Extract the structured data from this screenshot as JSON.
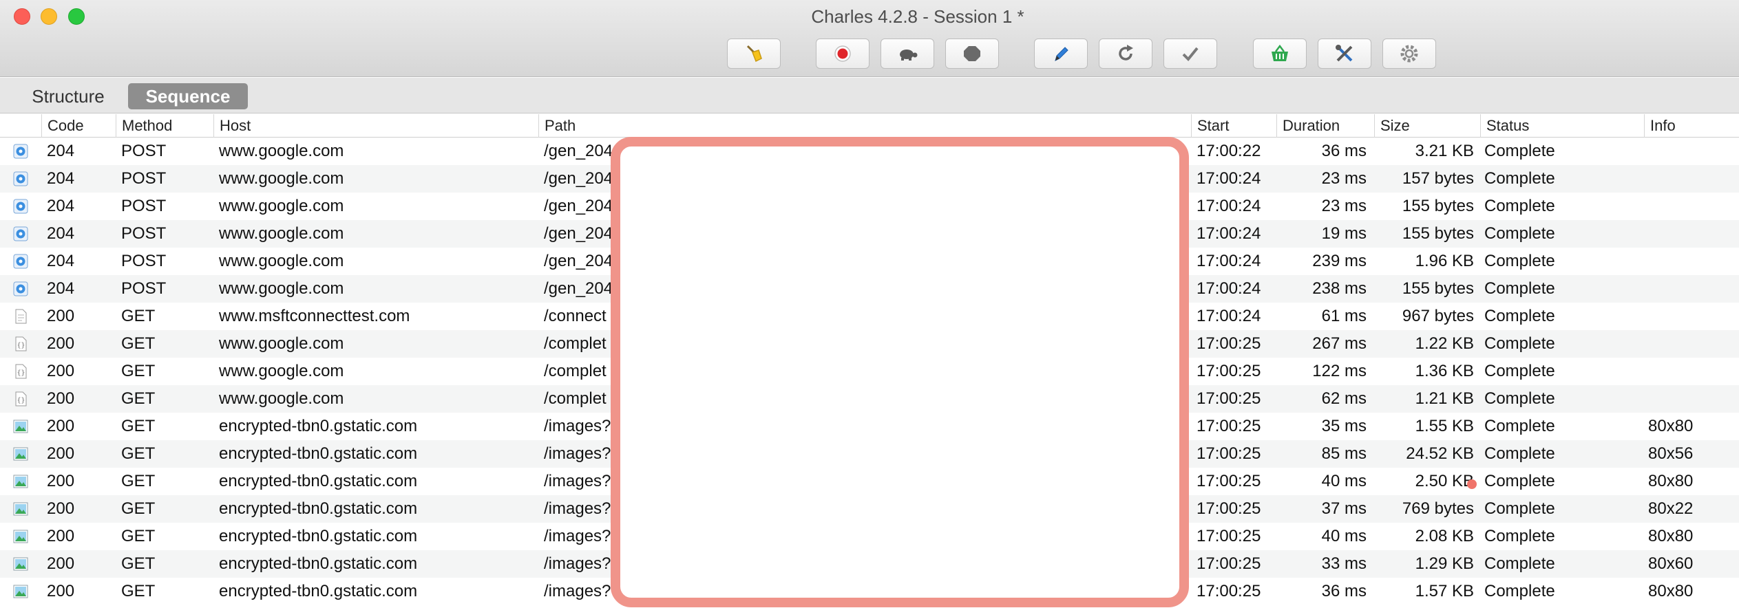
{
  "window": {
    "title": "Charles 4.2.8 - Session 1 *"
  },
  "toolbar": {
    "buttons": [
      {
        "name": "broom-icon"
      },
      {
        "name": "record-icon"
      },
      {
        "name": "turtle-icon"
      },
      {
        "name": "stop-icon"
      },
      {
        "name": "pen-icon"
      },
      {
        "name": "repeat-icon"
      },
      {
        "name": "checkmark-icon"
      },
      {
        "name": "basket-icon"
      },
      {
        "name": "tools-icon"
      },
      {
        "name": "gear-icon"
      }
    ],
    "record_color": "#e0262b",
    "basket_color": "#2fa84f",
    "pen_color": "#2f7fd8"
  },
  "tabs": {
    "structure": "Structure",
    "sequence": "Sequence",
    "active": "Sequence"
  },
  "table": {
    "columns": {
      "code": "Code",
      "method": "Method",
      "host": "Host",
      "path": "Path",
      "start": "Start",
      "duration": "Duration",
      "size": "Size",
      "status": "Status",
      "info": "Info"
    },
    "rows": [
      {
        "icon": "globe",
        "code": "204",
        "method": "POST",
        "host": "www.google.com",
        "path": "/gen_204",
        "start": "17:00:22",
        "duration": "36 ms",
        "size": "3.21 KB",
        "status": "Complete",
        "info": ""
      },
      {
        "icon": "globe",
        "code": "204",
        "method": "POST",
        "host": "www.google.com",
        "path": "/gen_204",
        "start": "17:00:24",
        "duration": "23 ms",
        "size": "157 bytes",
        "status": "Complete",
        "info": ""
      },
      {
        "icon": "globe",
        "code": "204",
        "method": "POST",
        "host": "www.google.com",
        "path": "/gen_204",
        "start": "17:00:24",
        "duration": "23 ms",
        "size": "155 bytes",
        "status": "Complete",
        "info": ""
      },
      {
        "icon": "globe",
        "code": "204",
        "method": "POST",
        "host": "www.google.com",
        "path": "/gen_204",
        "start": "17:00:24",
        "duration": "19 ms",
        "size": "155 bytes",
        "status": "Complete",
        "info": ""
      },
      {
        "icon": "globe",
        "code": "204",
        "method": "POST",
        "host": "www.google.com",
        "path": "/gen_204",
        "start": "17:00:24",
        "duration": "239 ms",
        "size": "1.96 KB",
        "status": "Complete",
        "info": ""
      },
      {
        "icon": "globe",
        "code": "204",
        "method": "POST",
        "host": "www.google.com",
        "path": "/gen_204",
        "start": "17:00:24",
        "duration": "238 ms",
        "size": "155 bytes",
        "status": "Complete",
        "info": ""
      },
      {
        "icon": "document",
        "code": "200",
        "method": "GET",
        "host": "www.msftconnecttest.com",
        "path": "/connect",
        "start": "17:00:24",
        "duration": "61 ms",
        "size": "967 bytes",
        "status": "Complete",
        "info": ""
      },
      {
        "icon": "json",
        "code": "200",
        "method": "GET",
        "host": "www.google.com",
        "path": "/complet",
        "start": "17:00:25",
        "duration": "267 ms",
        "size": "1.22 KB",
        "status": "Complete",
        "info": ""
      },
      {
        "icon": "json",
        "code": "200",
        "method": "GET",
        "host": "www.google.com",
        "path": "/complet",
        "start": "17:00:25",
        "duration": "122 ms",
        "size": "1.36 KB",
        "status": "Complete",
        "info": ""
      },
      {
        "icon": "json",
        "code": "200",
        "method": "GET",
        "host": "www.google.com",
        "path": "/complet",
        "start": "17:00:25",
        "duration": "62 ms",
        "size": "1.21 KB",
        "status": "Complete",
        "info": ""
      },
      {
        "icon": "image",
        "code": "200",
        "method": "GET",
        "host": "encrypted-tbn0.gstatic.com",
        "path": "/images?",
        "start": "17:00:25",
        "duration": "35 ms",
        "size": "1.55 KB",
        "status": "Complete",
        "info": "80x80"
      },
      {
        "icon": "image",
        "code": "200",
        "method": "GET",
        "host": "encrypted-tbn0.gstatic.com",
        "path": "/images?",
        "start": "17:00:25",
        "duration": "85 ms",
        "size": "24.52 KB",
        "status": "Complete",
        "info": "80x56"
      },
      {
        "icon": "image",
        "code": "200",
        "method": "GET",
        "host": "encrypted-tbn0.gstatic.com",
        "path": "/images?",
        "start": "17:00:25",
        "duration": "40 ms",
        "size": "2.50 KB",
        "status": "Complete",
        "info": "80x80"
      },
      {
        "icon": "image",
        "code": "200",
        "method": "GET",
        "host": "encrypted-tbn0.gstatic.com",
        "path": "/images?",
        "start": "17:00:25",
        "duration": "37 ms",
        "size": "769 bytes",
        "status": "Complete",
        "info": "80x22"
      },
      {
        "icon": "image",
        "code": "200",
        "method": "GET",
        "host": "encrypted-tbn0.gstatic.com",
        "path": "/images?",
        "start": "17:00:25",
        "duration": "40 ms",
        "size": "2.08 KB",
        "status": "Complete",
        "info": "80x80"
      },
      {
        "icon": "image",
        "code": "200",
        "method": "GET",
        "host": "encrypted-tbn0.gstatic.com",
        "path": "/images?",
        "start": "17:00:25",
        "duration": "33 ms",
        "size": "1.29 KB",
        "status": "Complete",
        "info": "80x60"
      },
      {
        "icon": "image",
        "code": "200",
        "method": "GET",
        "host": "encrypted-tbn0.gstatic.com",
        "path": "/images?",
        "start": "17:00:25",
        "duration": "36 ms",
        "size": "1.57 KB",
        "status": "Complete",
        "info": "80x80"
      }
    ]
  },
  "overlay": {
    "color": "#f0948a"
  }
}
